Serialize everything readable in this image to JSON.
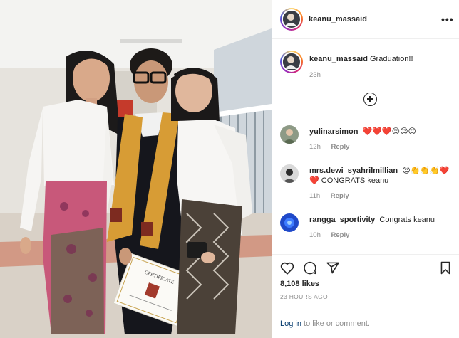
{
  "post": {
    "username": "keanu_massaid",
    "caption": "Graduation!!",
    "time": "23h",
    "likes": "8,108 likes",
    "posted_ago": "23 HOURS AGO"
  },
  "header": {
    "more_glyph": "•••"
  },
  "comments": [
    {
      "username": "yulinarsimon",
      "text": "❤️❤️❤️😍😍😍",
      "time": "12h",
      "reply": "Reply"
    },
    {
      "username": "mrs.dewi_syahrilmillian",
      "text": "😍👏👏👏❤️❤️ CONGRATS keanu",
      "time": "11h",
      "reply": "Reply"
    },
    {
      "username": "rangga_sportivity",
      "text": "Congrats keanu",
      "time": "10h",
      "reply": "Reply"
    }
  ],
  "footer": {
    "login_link": "Log in",
    "login_rest": " to like or comment."
  },
  "icons": {
    "more": "more-options-icon",
    "add": "add-circle-icon",
    "like": "heart-icon",
    "comment": "comment-icon",
    "share": "paper-plane-icon",
    "save": "bookmark-icon"
  },
  "photo": {
    "certificate_heading": "CERTIFICATE"
  },
  "colors": {
    "link": "#00376b",
    "muted": "#8e8e8e",
    "text": "#262626",
    "border": "#efefef"
  }
}
